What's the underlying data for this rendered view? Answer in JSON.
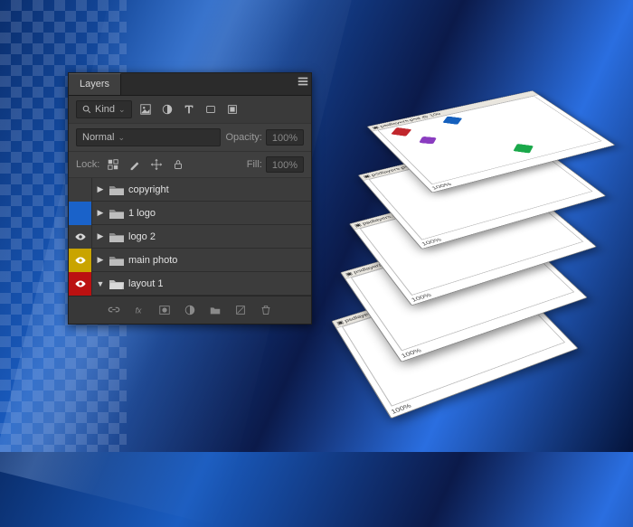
{
  "panel": {
    "tab": "Layers",
    "filter": {
      "kind_label": "Kind"
    },
    "blend": {
      "mode": "Normal",
      "opacity_label": "Opacity:",
      "opacity_value": "100%"
    },
    "lock": {
      "label": "Lock:",
      "fill_label": "Fill:",
      "fill_value": "100%"
    }
  },
  "layers": [
    {
      "visColor": "none",
      "eye": false,
      "expanded": false,
      "open": false,
      "name": "copyright"
    },
    {
      "visColor": "blue",
      "eye": false,
      "expanded": false,
      "open": false,
      "name": "1 logo"
    },
    {
      "visColor": "none",
      "eye": true,
      "expanded": false,
      "open": false,
      "name": "logo 2"
    },
    {
      "visColor": "yellow",
      "eye": true,
      "expanded": false,
      "open": false,
      "name": "main photo"
    },
    {
      "visColor": "red",
      "eye": true,
      "expanded": true,
      "open": true,
      "name": "layout 1"
    }
  ],
  "stack": {
    "doc_title_prefix": "psdlayers.psd @ 100",
    "zoom": "100%"
  }
}
